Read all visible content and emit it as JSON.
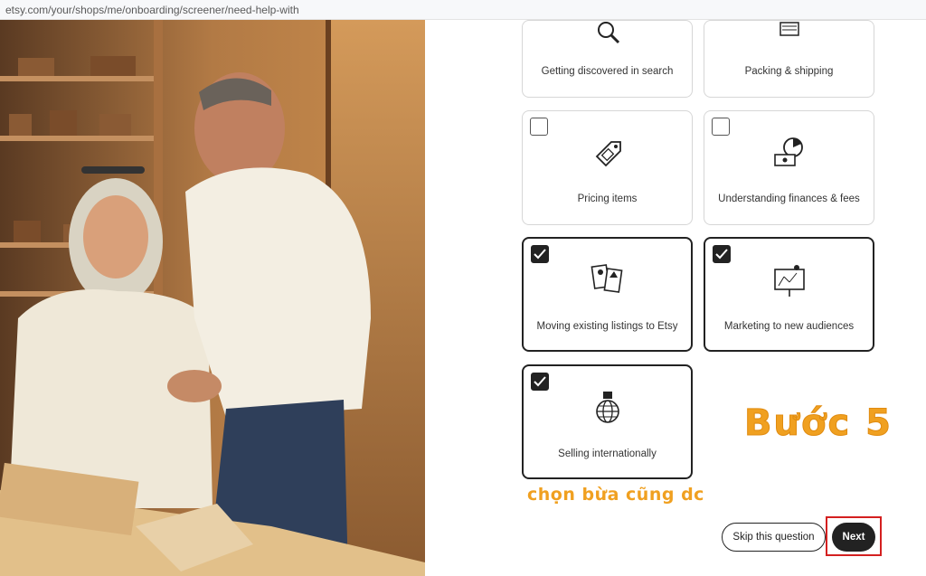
{
  "browser": {
    "url": "etsy.com/your/shops/me/onboarding/screener/need-help-with"
  },
  "options": [
    {
      "label": "Getting discovered in search",
      "checked": false,
      "icon": "magnifier-icon"
    },
    {
      "label": "Packing & shipping",
      "checked": false,
      "icon": "package-icon"
    },
    {
      "label": "Pricing items",
      "checked": false,
      "icon": "price-tag-icon"
    },
    {
      "label": "Understanding finances & fees",
      "checked": false,
      "icon": "finance-chart-icon"
    },
    {
      "label": "Moving existing listings to Etsy",
      "checked": true,
      "icon": "listings-icon"
    },
    {
      "label": "Marketing to new audiences",
      "checked": true,
      "icon": "marketing-board-icon"
    },
    {
      "label": "Selling internationally",
      "checked": true,
      "icon": "globe-icon"
    }
  ],
  "annotations": {
    "step": "Bước 5",
    "note": "chọn bừa cũng dc"
  },
  "actions": {
    "skip_label": "Skip this question",
    "next_label": "Next"
  },
  "colors": {
    "accent": "#222222",
    "annotation": "#f0a020",
    "highlight": "#d42020"
  }
}
